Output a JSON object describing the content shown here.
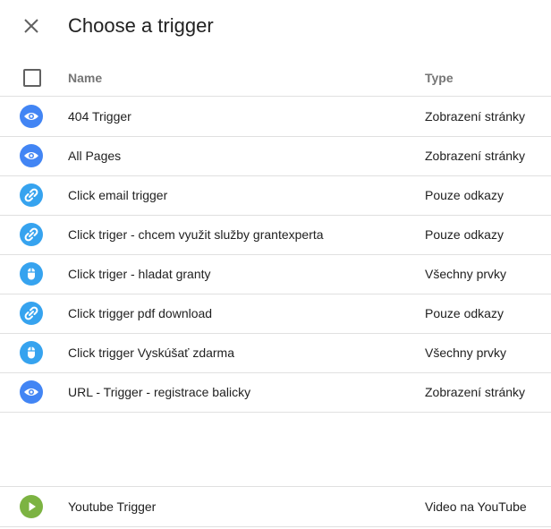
{
  "dialog": {
    "title": "Choose a trigger"
  },
  "table": {
    "col_name": "Name",
    "col_type": "Type"
  },
  "triggers": [
    {
      "name": "404 Trigger",
      "type": "Zobrazení stránky",
      "icon": "eye-icon",
      "color": "#4285f4"
    },
    {
      "name": "All Pages",
      "type": "Zobrazení stránky",
      "icon": "eye-icon",
      "color": "#4285f4"
    },
    {
      "name": "Click email trigger",
      "type": "Pouze odkazy",
      "icon": "link-icon",
      "color": "#36a3ef"
    },
    {
      "name": "Click triger - chcem využit služby grantexperta",
      "type": "Pouze odkazy",
      "icon": "link-icon",
      "color": "#36a3ef"
    },
    {
      "name": "Click triger - hladat granty",
      "type": "Všechny prvky",
      "icon": "mouse-icon",
      "color": "#36a3ef"
    },
    {
      "name": "Click trigger pdf download",
      "type": "Pouze odkazy",
      "icon": "link-icon",
      "color": "#36a3ef"
    },
    {
      "name": "Click trigger Vyskúšať zdarma",
      "type": "Všechny prvky",
      "icon": "mouse-icon",
      "color": "#36a3ef"
    },
    {
      "name": "URL - Trigger - registrace balicky",
      "type": "Zobrazení stránky",
      "icon": "eye-icon",
      "color": "#4285f4"
    },
    {
      "name": "Youtube Trigger",
      "type": "Video na YouTube",
      "icon": "play-icon",
      "color": "#7cb342"
    }
  ]
}
